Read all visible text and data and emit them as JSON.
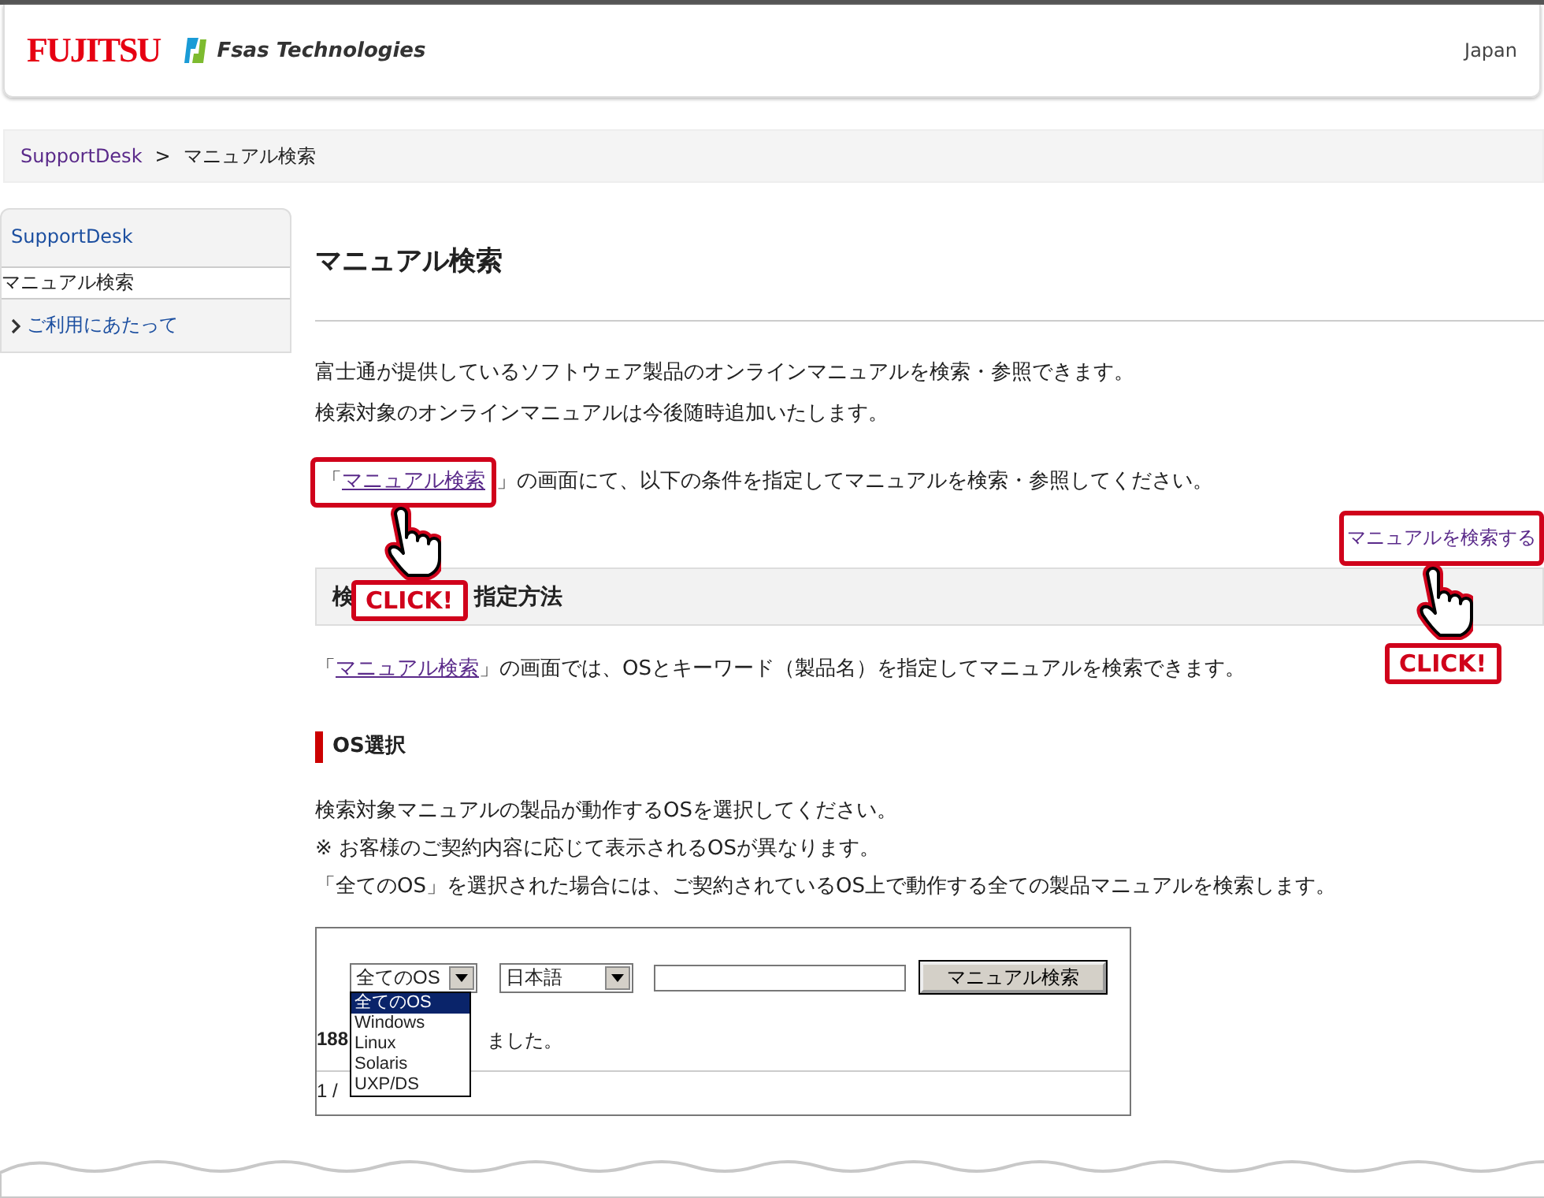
{
  "header": {
    "logo": "FUJITSU",
    "brand": "Fsas Technologies",
    "region": "Japan"
  },
  "breadcrumb": {
    "items": [
      "SupportDesk",
      "マニュアル検索"
    ],
    "separator": ">"
  },
  "sidebar": {
    "title": "SupportDesk",
    "current": "マニュアル検索",
    "items": [
      "ご利用にあたって"
    ]
  },
  "page_title": "マニュアル検索",
  "intro": [
    "富士通が提供しているソフトウェア製品のオンラインマニュアルを検索・参照できます。",
    "検索対象のオンラインマニュアルは今後随時追加いたします。"
  ],
  "instruction": {
    "before": "「",
    "link": "マニュアル検索",
    "after": "」の画面にて、以下の条件を指定してマニュアルを検索・参照してください。"
  },
  "search_link": "マニュアルを検索する",
  "click_badges": [
    "CLICK!",
    "CLICK!"
  ],
  "section": {
    "heading_parts": [
      "検",
      "指定方法"
    ],
    "before": "「",
    "link": "マニュアル検索",
    "after": "」の画面では、OSとキーワード（製品名）を指定してマニュアルを検索できます。"
  },
  "os_section": {
    "heading": "OS選択",
    "lines": [
      "検索対象マニュアルの製品が動作するOSを選択してください。",
      "※ お客様のご契約内容に応じて表示されるOSが異なります。",
      "「全てのOS」を選択された場合には、ご契約されているOS上で動作する全ての製品マニュアルを検索します。"
    ]
  },
  "demo": {
    "os_select": "全てのOS",
    "lang_select": "日本語",
    "button": "マニュアル検索",
    "os_options": [
      {
        "label": "全てのOS",
        "selected": true
      },
      {
        "label": "Windows",
        "selected": false
      },
      {
        "label": "Linux",
        "selected": false
      },
      {
        "label": "Solaris",
        "selected": false
      },
      {
        "label": "UXP/DS",
        "selected": false
      }
    ],
    "result_parts": [
      "188",
      "ました。"
    ],
    "page": "1 /"
  }
}
